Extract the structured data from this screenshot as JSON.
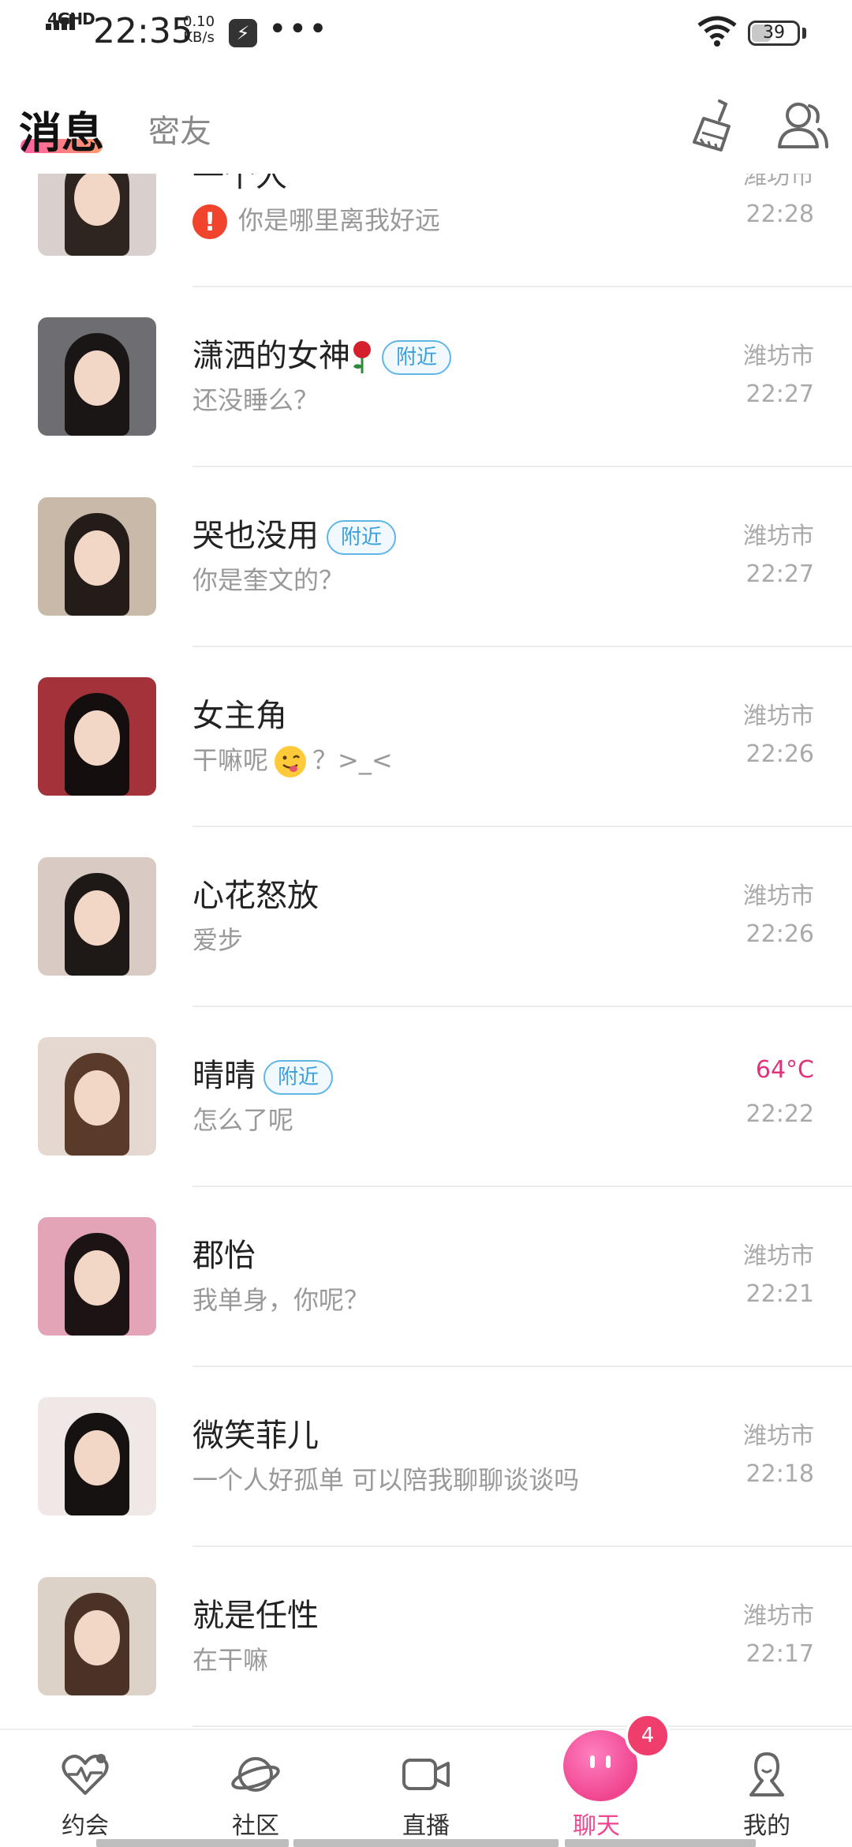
{
  "status_bar": {
    "network": "4GHD",
    "time": "22:35",
    "speed_value": "0.10",
    "speed_unit": "KB/s",
    "more": "•••",
    "battery": "39"
  },
  "header": {
    "tab_messages": "消息",
    "tab_friends": "密友"
  },
  "conversations": [
    {
      "name": "一个人",
      "message": "你是哪里离我好远",
      "city": "潍坊市",
      "time": "22:28",
      "warning": true
    },
    {
      "name": "潇洒的女神",
      "badge": "附近",
      "message": "还没睡么？",
      "city": "潍坊市",
      "time": "22:27",
      "rose": true
    },
    {
      "name": "哭也没用",
      "badge": "附近",
      "message": "你是奎文的？",
      "city": "潍坊市",
      "time": "22:27"
    },
    {
      "name": "女主角",
      "message_pre": "干嘛呢",
      "message_post": "？>_<",
      "city": "潍坊市",
      "time": "22:26",
      "emoji": true
    },
    {
      "name": "心花怒放",
      "message": "爱步",
      "city": "潍坊市",
      "time": "22:26"
    },
    {
      "name": "晴晴",
      "badge": "附近",
      "message": "怎么了呢",
      "city": "64°C",
      "time": "22:22",
      "city_color": "#e0337a"
    },
    {
      "name": "郡怡",
      "message": "我单身，你呢？",
      "city": "潍坊市",
      "time": "22:21"
    },
    {
      "name": "微笑菲儿",
      "message": "一个人好孤单 可以陪我聊聊谈谈吗",
      "city": "潍坊市",
      "time": "22:18"
    },
    {
      "name": "就是任性",
      "message": "在干嘛",
      "city": "潍坊市",
      "time": "22:17"
    }
  ],
  "bottom_nav": {
    "items": [
      {
        "label": "约会",
        "icon": "heart-pulse-icon"
      },
      {
        "label": "社区",
        "icon": "planet-icon"
      },
      {
        "label": "直播",
        "icon": "video-camera-icon"
      },
      {
        "label": "聊天",
        "icon": "chat-bubble-icon",
        "badge": "4",
        "active": true
      },
      {
        "label": "我的",
        "icon": "profile-icon"
      }
    ]
  },
  "colors": {
    "accent": "#f0458f",
    "nearby_badge": "#3aa0dd",
    "warning": "#f0452c"
  }
}
